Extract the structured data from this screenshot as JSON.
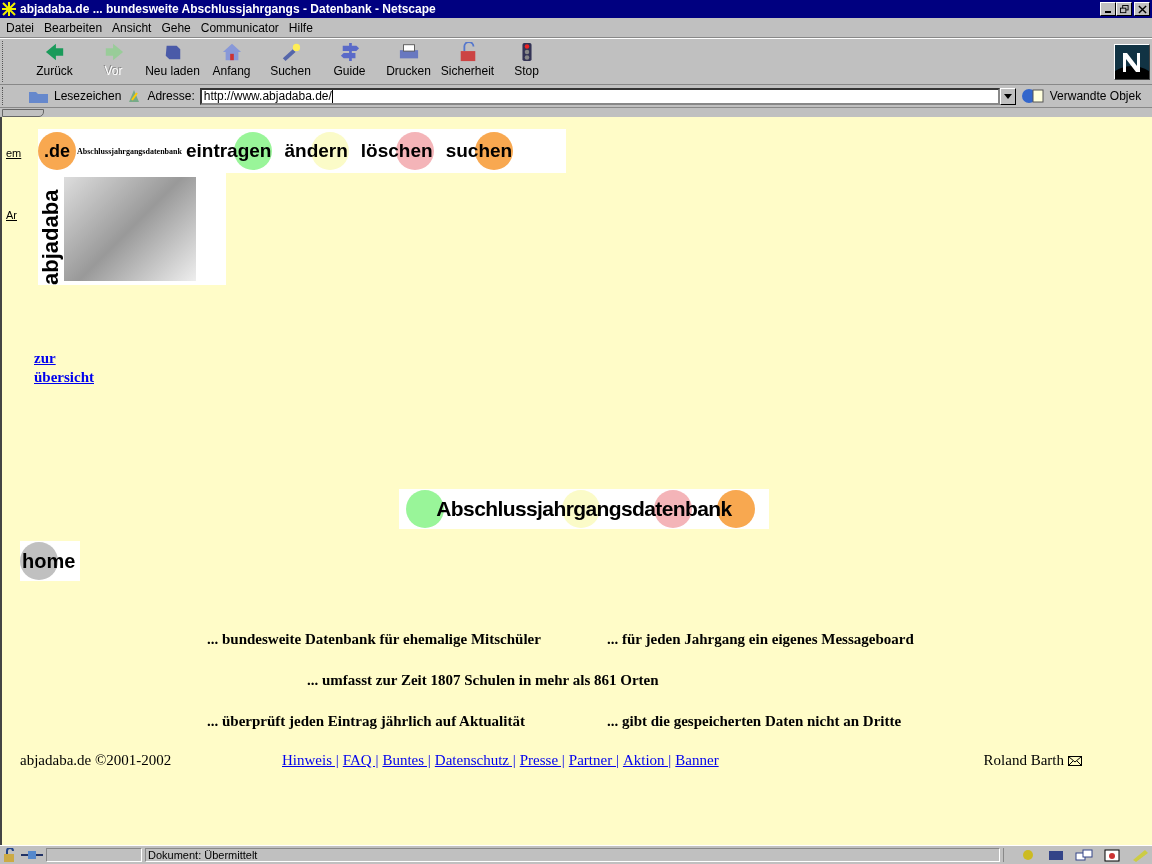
{
  "window": {
    "title": "abjadaba.de ... bundesweite Abschlussjahrgangs - Datenbank - Netscape"
  },
  "menu": [
    "Datei",
    "Bearbeiten",
    "Ansicht",
    "Gehe",
    "Communicator",
    "Hilfe"
  ],
  "toolbar": [
    {
      "label": "Zurück",
      "kind": "back",
      "disabled": false
    },
    {
      "label": "Vor",
      "kind": "forward",
      "disabled": true
    },
    {
      "label": "Neu laden",
      "kind": "reload",
      "disabled": false
    },
    {
      "label": "Anfang",
      "kind": "home",
      "disabled": false
    },
    {
      "label": "Suchen",
      "kind": "search",
      "disabled": false
    },
    {
      "label": "Guide",
      "kind": "guide",
      "disabled": false
    },
    {
      "label": "Drucken",
      "kind": "print",
      "disabled": false
    },
    {
      "label": "Sicherheit",
      "kind": "security",
      "disabled": false
    },
    {
      "label": "Stop",
      "kind": "stop",
      "disabled": false
    }
  ],
  "location": {
    "bookmarks": "Lesezeichen",
    "address_label": "Adresse:",
    "url": "http://www.abjadaba.de/",
    "related": "Verwandte Objek"
  },
  "page": {
    "side_fragments": [
      "em",
      "Ar"
    ],
    "logo": {
      "domain": ".de",
      "name": "abjadaba",
      "tagline": "Abschlussjahrgangsdatenbank"
    },
    "nav": [
      {
        "label": "eintragen",
        "color": "#99f599"
      },
      {
        "label": "ändern",
        "color": "#fbfbc8"
      },
      {
        "label": "löschen",
        "color": "#f4b4b8"
      },
      {
        "label": "suchen",
        "color": "#f8a850"
      }
    ],
    "overview_link": [
      "zur",
      "übersicht"
    ],
    "banner": {
      "text": "Abschlussjahrgangsdatenbank",
      "circles": [
        {
          "color": "#99f599"
        },
        {
          "color": "#fbfbc8"
        },
        {
          "color": "#f4b4b8"
        },
        {
          "color": "#f8a850"
        }
      ]
    },
    "home": {
      "label": "home",
      "color": "#c0c0c0"
    },
    "features": [
      [
        "... bundesweite Datenbank für ehemalige Mitschüler",
        "... für jeden Jahrgang ein eigenes Messageboard"
      ],
      [
        "... umfasst zur Zeit 1807 Schulen in mehr als 861 Orten"
      ],
      [
        "... überprüft jeden Eintrag jährlich auf Aktualität",
        "... gibt die gespeicherten Daten nicht an Dritte"
      ]
    ],
    "footer": {
      "copyright": "abjadaba.de ©2001-2002",
      "links": [
        "Hinweis |",
        "FAQ |",
        "Buntes |",
        "Datenschutz |",
        "Presse |",
        "Partner |",
        "Aktion |",
        "Banner"
      ],
      "author": "Roland Barth"
    }
  },
  "status_bar": {
    "text": "Dokument: Übermittelt"
  }
}
